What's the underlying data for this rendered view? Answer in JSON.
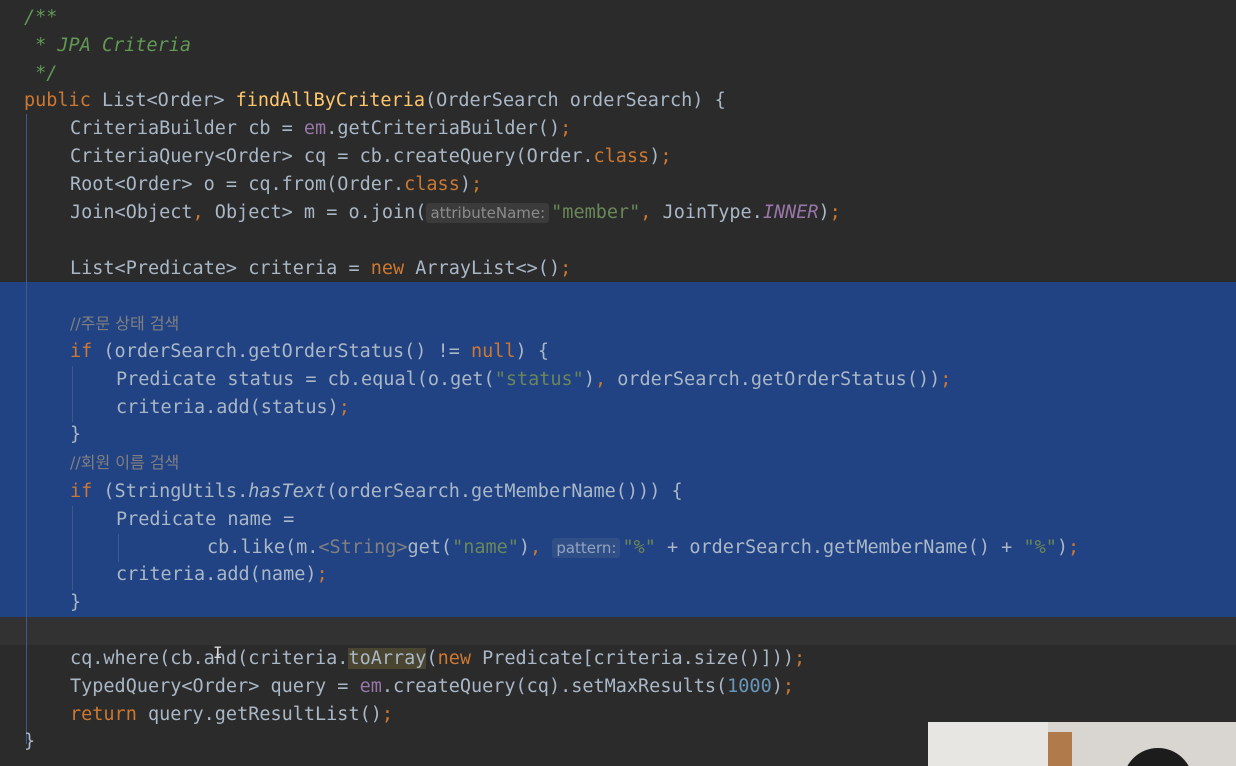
{
  "code_lines": {
    "l1": "/**",
    "l2": " * JPA Criteria",
    "l3": " */",
    "l4_kw": "public",
    "l4_type": " List<Order> ",
    "l4_fn": "findAllByCriteria",
    "l4_rest": "(OrderSearch orderSearch) {",
    "l5_a": "CriteriaBuilder cb = ",
    "l5_em": "em",
    "l5_b": ".getCriteriaBuilder()",
    "l5_semi": ";",
    "l6_a": "CriteriaQuery<Order> cq = cb.createQuery(Order.",
    "l6_cls": "class",
    "l6_b": ")",
    "l6_semi": ";",
    "l7_a": "Root<Order> o = cq.from(Order.",
    "l7_cls": "class",
    "l7_b": ")",
    "l7_semi": ";",
    "l8_a": "Join<Object",
    "l8_comma": ",",
    "l8_b": " Object> m = o.join(",
    "l8_hint": "attributeName:",
    "l8_str": "\"member\"",
    "l8_comma2": ",",
    "l8_c": " JoinType.",
    "l8_enum": "INNER",
    "l8_d": ")",
    "l8_semi": ";",
    "l10_a": "List<Predicate> criteria = ",
    "l10_new": "new",
    "l10_b": " ArrayList<>()",
    "l10_semi": ";",
    "l12": "//주문 상태 검색",
    "l13_if": "if",
    "l13_a": " (orderSearch.getOrderStatus() != ",
    "l13_null": "null",
    "l13_b": ") {",
    "l14_a": "Predicate status = cb.equal(o.get(",
    "l14_str": "\"status\"",
    "l14_b": ")",
    "l14_comma": ",",
    "l14_c": " orderSearch.getOrderStatus())",
    "l14_semi": ";",
    "l15_a": "criteria.add(status)",
    "l15_semi": ";",
    "l16": "}",
    "l17": "//회원 이름 검색",
    "l18_if": "if",
    "l18_a": " (StringUtils.",
    "l18_it": "hasText",
    "l18_b": "(orderSearch.getMemberName())) {",
    "l19": "Predicate name =",
    "l20_a": "cb.like(m.",
    "l20_gen": "<String>",
    "l20_b": "get(",
    "l20_str": "\"name\"",
    "l20_c": ")",
    "l20_comma": ",",
    "l20_hint": "pattern:",
    "l20_str2": "\"%\"",
    "l20_d": " + orderSearch.getMemberName() + ",
    "l20_str3": "\"%\"",
    "l20_e": ")",
    "l20_semi": ";",
    "l21_a": "criteria.add(name)",
    "l21_semi": ";",
    "l22": "}",
    "l24_a": "cq.where(cb.and(criteria.",
    "l24_hl": "toArray",
    "l24_b": "(",
    "l24_new": "new",
    "l24_c": " Predicate[criteria.size()]))",
    "l24_semi": ";",
    "l25_a": "TypedQuery<Order> query = ",
    "l25_em": "em",
    "l25_b": ".createQuery(cq).setMaxResults(",
    "l25_num": "1000",
    "l25_c": ")",
    "l25_semi": ";",
    "l26_ret": "return",
    "l26_a": " query.getResultList()",
    "l26_semi": ";",
    "l27": "}"
  },
  "colors": {
    "background": "#2b2b2b",
    "selection": "#214283",
    "keyword": "#cc7832",
    "string": "#6a8759",
    "method": "#ffc66d",
    "number": "#6897bb",
    "field": "#9876aa"
  }
}
